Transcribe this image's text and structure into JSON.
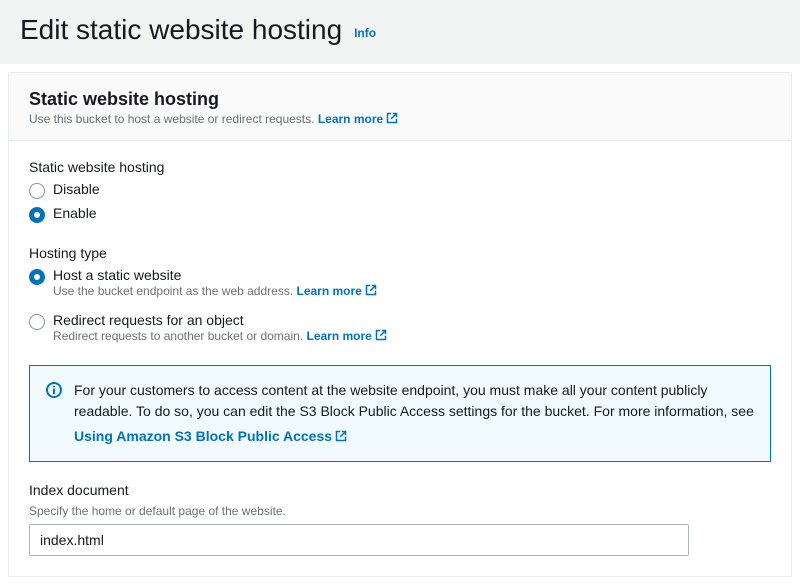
{
  "header": {
    "title": "Edit static website hosting",
    "info_label": "Info"
  },
  "panel": {
    "title": "Static website hosting",
    "desc_text": "Use this bucket to host a website or redirect requests. ",
    "learn_more": "Learn more"
  },
  "hosting_toggle": {
    "label": "Static website hosting",
    "options": {
      "disable": "Disable",
      "enable": "Enable"
    }
  },
  "hosting_type": {
    "label": "Hosting type",
    "host_static": {
      "label": "Host a static website",
      "desc_text": "Use the bucket endpoint as the web address. ",
      "learn_more": "Learn more"
    },
    "redirect": {
      "label": "Redirect requests for an object",
      "desc_text": "Redirect requests to another bucket or domain. ",
      "learn_more": "Learn more"
    }
  },
  "info_box": {
    "text": "For your customers to access content at the website endpoint, you must make all your content publicly readable. To do so, you can edit the S3 Block Public Access settings for the bucket. For more information, see ",
    "link_text": "Using Amazon S3 Block Public Access"
  },
  "index_document": {
    "label": "Index document",
    "sublabel": "Specify the home or default page of the website.",
    "value": "index.html"
  }
}
